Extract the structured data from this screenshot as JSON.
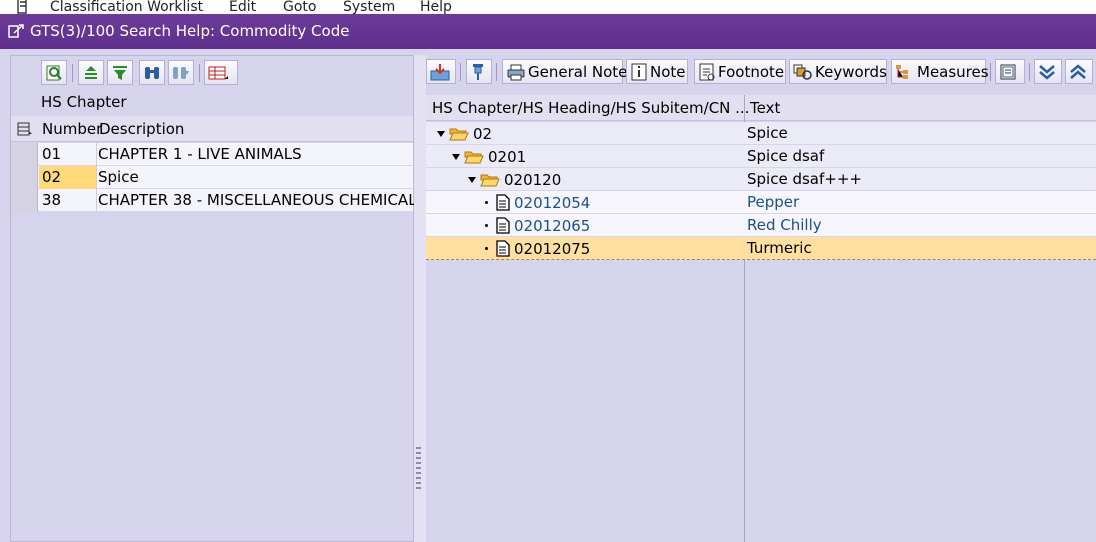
{
  "menu": {
    "items": [
      "Classification Worklist",
      "Edit",
      "Goto",
      "System",
      "Help"
    ]
  },
  "window": {
    "title": "GTS(3)/100 Search Help: Commodity Code"
  },
  "left": {
    "section_title": "HS Chapter",
    "columns": [
      "Number",
      "Description"
    ],
    "rows": [
      {
        "number": "01",
        "description": "CHAPTER 1 - LIVE ANIMALS"
      },
      {
        "number": "02",
        "description": "Spice"
      },
      {
        "number": "38",
        "description": "CHAPTER 38 - MISCELLANEOUS CHEMICAL"
      }
    ],
    "selected_index": 1
  },
  "right": {
    "toolbar": {
      "general_note": "General Note",
      "note": "Note",
      "footnote": "Footnote",
      "keywords": "Keywords",
      "measures": "Measures"
    },
    "columns": [
      "HS Chapter/HS Heading/HS Subitem/CN ...",
      "Text"
    ],
    "tree": [
      {
        "code": "02",
        "text": "Spice"
      },
      {
        "code": "0201",
        "text": "Spice dsaf"
      },
      {
        "code": "020120",
        "text": "Spice dsaf+++"
      },
      {
        "code": "02012054",
        "text": "Pepper"
      },
      {
        "code": "02012065",
        "text": "Red Chilly"
      },
      {
        "code": "02012075",
        "text": "Turmeric"
      }
    ]
  },
  "colors": {
    "title_bar": "#5f2f8c",
    "selection": "#ffd97a",
    "link": "#1d4f8a",
    "background": "#d6d3ec"
  }
}
